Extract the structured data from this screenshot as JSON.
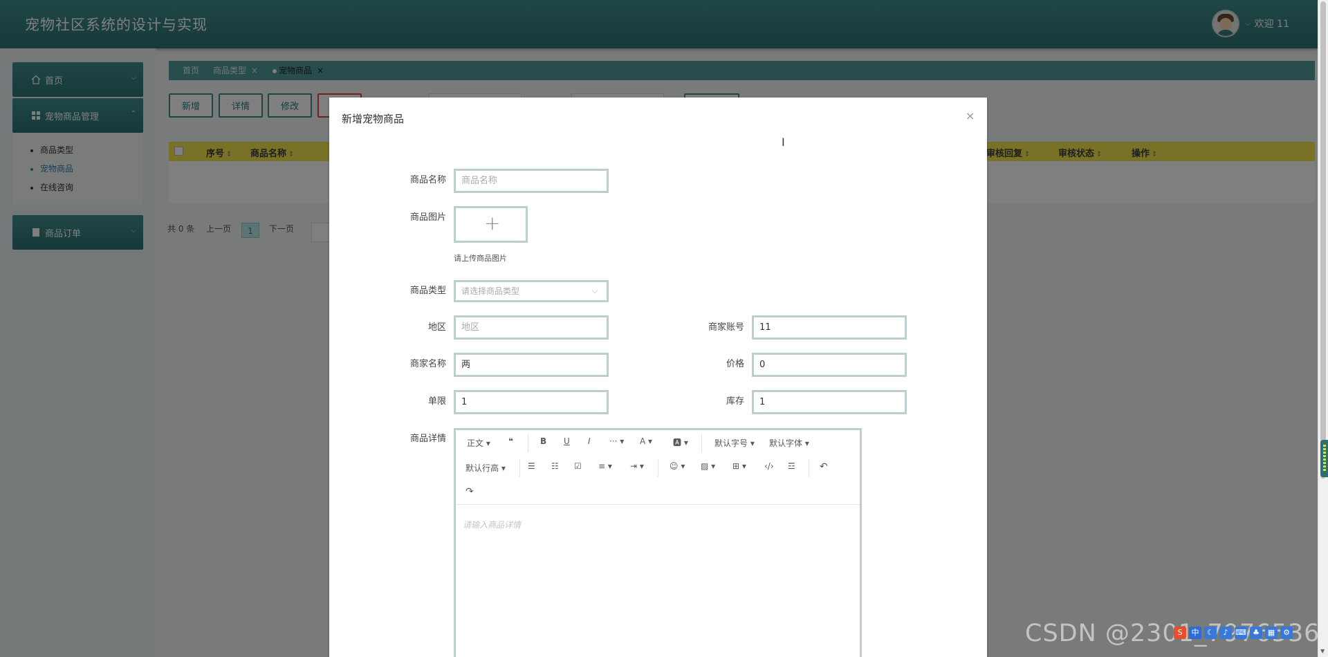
{
  "header": {
    "title": "宠物社区系统的设计与实现",
    "welcome": "欢迎 11"
  },
  "sidebar": {
    "home": "首页",
    "pet_goods_mgmt": "宠物商品管理",
    "sub_items": [
      "商品类型",
      "宠物商品",
      "在线咨询"
    ],
    "orders": "商品订单"
  },
  "tabs": [
    {
      "label": "首页"
    },
    {
      "label": "商品类型"
    },
    {
      "label": "宠物商品"
    }
  ],
  "toolbar_buttons": [
    "新增",
    "详情",
    "修改"
  ],
  "table_headers": [
    "序号",
    "商品名称",
    "审核回复",
    "审核状态",
    "操作"
  ],
  "pager": {
    "total": "共 0 条",
    "prev": "上一页",
    "current": "1",
    "next": "下一页"
  },
  "dialog": {
    "title": "新增宠物商品",
    "close": "×",
    "fields": {
      "name": {
        "label": "商品名称",
        "placeholder": "商品名称"
      },
      "image": {
        "label": "商品图片",
        "tip": "请上传商品图片"
      },
      "type": {
        "label": "商品类型",
        "placeholder": "请选择商品类型"
      },
      "region": {
        "label": "地区",
        "placeholder": "地区"
      },
      "merchant_account": {
        "label": "商家账号",
        "value": "11"
      },
      "merchant_name": {
        "label": "商家名称",
        "value": "两"
      },
      "price": {
        "label": "价格",
        "value": "0"
      },
      "limit": {
        "label": "单限",
        "value": "1"
      },
      "stock": {
        "label": "库存",
        "value": "1"
      },
      "detail": {
        "label": "商品详情",
        "placeholder": "请输入商品详情"
      }
    },
    "editor_toolbar": {
      "paragraph": "正文",
      "font_size": "默认字号",
      "font_family": "默认字体",
      "line_height": "默认行高"
    }
  },
  "watermark": "CSDN @2301_7976536",
  "colors": {
    "header": "#2e7373",
    "accent": "#3f8a8a",
    "table_header": "#f3e24b",
    "active_link": "#2f7fb3"
  }
}
